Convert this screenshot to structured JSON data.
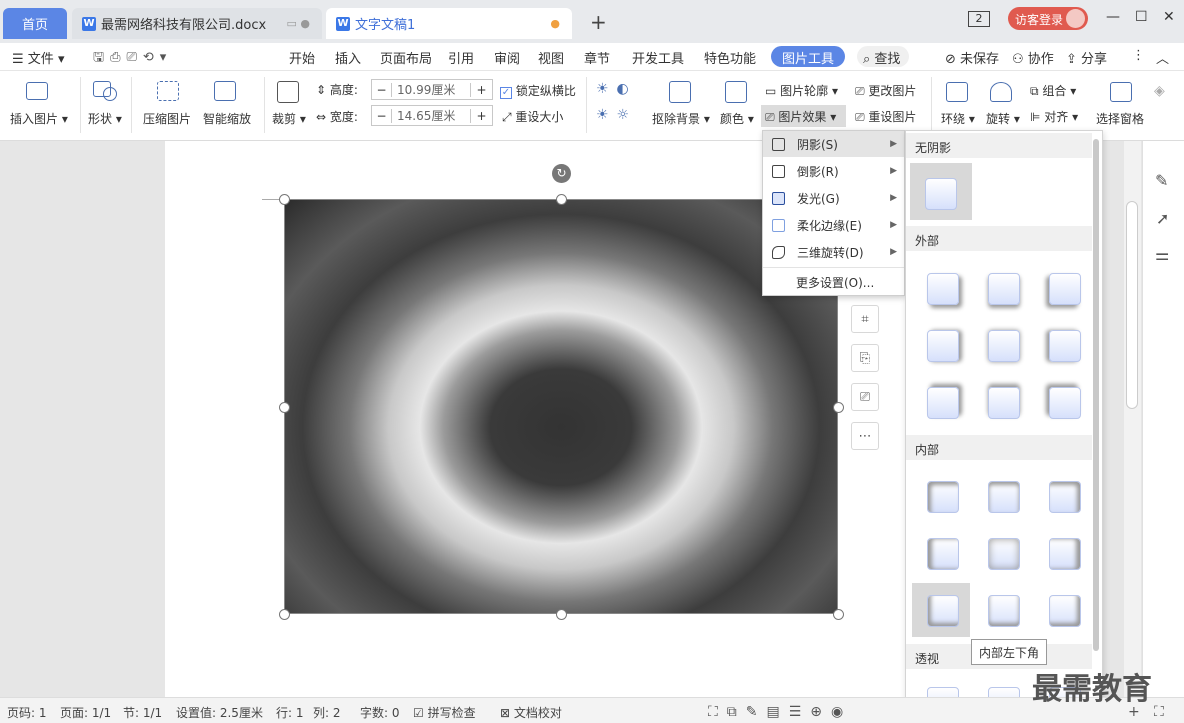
{
  "tabs": {
    "home": "首页",
    "doc1": "最需网络科技有限公司.docx",
    "doc2": "文字文稿1",
    "new_tab": "+",
    "page_count": "2"
  },
  "account": {
    "login": "访客登录"
  },
  "window": {
    "minimize": "—",
    "maximize": "☐",
    "close": "✕"
  },
  "menubar": {
    "file": "文件",
    "items": [
      "开始",
      "插入",
      "页面布局",
      "引用",
      "审阅",
      "视图",
      "章节",
      "开发工具",
      "特色功能"
    ],
    "active": "图片工具",
    "search": "查找",
    "unsaved": "未保存",
    "collab": "协作",
    "share": "分享"
  },
  "ribbon": {
    "insert_pic": "插入图片",
    "shape": "形状",
    "compress": "压缩图片",
    "smart_zoom": "智能缩放",
    "crop": "裁剪",
    "height_label": "高度:",
    "height_value": "10.99厘米",
    "width_label": "宽度:",
    "width_value": "14.65厘米",
    "lock_ratio": "锁定纵横比",
    "reset_size": "重设大小",
    "remove_bg": "抠除背景",
    "color": "颜色",
    "outline": "图片轮廓",
    "change_pic": "更改图片",
    "effects": "图片效果",
    "reset_pic": "重设图片",
    "wrap": "环绕",
    "rotate": "旋转",
    "group": "组合",
    "align": "对齐",
    "select_pane": "选择窗格"
  },
  "effects_menu": {
    "items": [
      "阴影(S)",
      "倒影(R)",
      "发光(G)",
      "柔化边缘(E)",
      "三维旋转(D)"
    ],
    "more": "更多设置(O)..."
  },
  "shadow_panel": {
    "no_shadow": "无阴影",
    "outer": "外部",
    "inner": "内部",
    "perspective": "透视",
    "tooltip": "内部左下角"
  },
  "status": {
    "page": "页码: 1",
    "pages": "页面: 1/1",
    "section": "节: 1/1",
    "setting": "设置值: 2.5厘米",
    "row": "行: 1",
    "col": "列: 2",
    "words": "字数: 0",
    "spell": "拼写检查",
    "proof": "文档校对"
  },
  "watermark": "最需教育",
  "colors": {
    "accent": "#5b86e5",
    "active_tab": "#3f6fd8",
    "login": "#e05a4f"
  }
}
